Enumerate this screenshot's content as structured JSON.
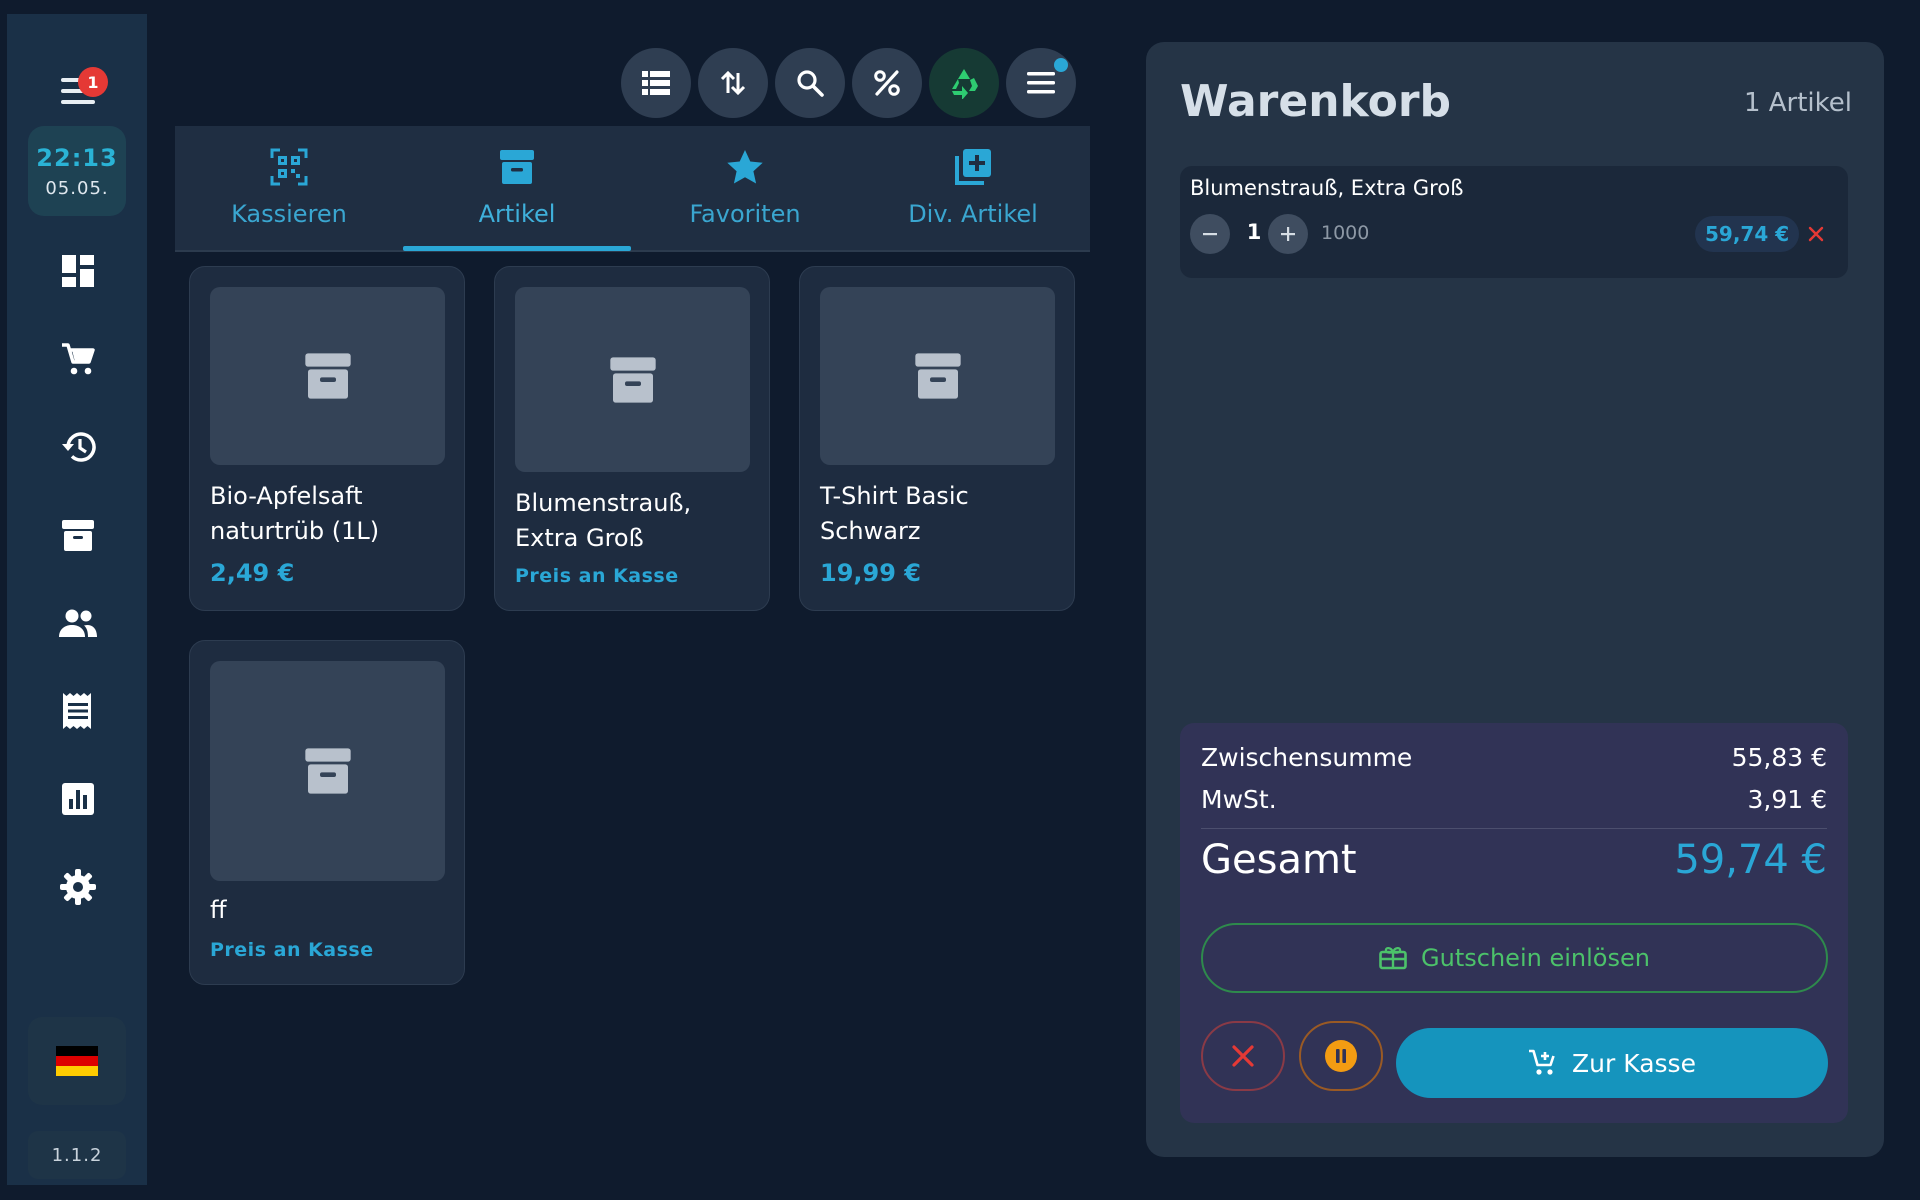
{
  "sidebar": {
    "menu_badge": "1",
    "clock_time": "22:13",
    "clock_date": "05.05.",
    "nav_icons": [
      "dashboard-icon",
      "cart-icon",
      "history-icon",
      "archive-icon",
      "customers-icon",
      "receipt-icon",
      "report-icon",
      "settings-icon"
    ],
    "language_flag": "de-flag-icon",
    "version": "1.1.2"
  },
  "toolbar": {
    "icons": [
      "list-view-icon",
      "sort-icon",
      "search-icon",
      "discount-icon",
      "recycle-icon",
      "menu-icon"
    ]
  },
  "tabs": [
    {
      "label": "Kassieren",
      "icon": "qr-scan-icon"
    },
    {
      "label": "Artikel",
      "icon": "archive-icon"
    },
    {
      "label": "Favoriten",
      "icon": "star-icon"
    },
    {
      "label": "Div. Artikel",
      "icon": "add-item-icon"
    }
  ],
  "active_tab": "Artikel",
  "products": [
    {
      "name": "Bio-Apfelsaft naturtrüb (1L)",
      "price": "2,49 €"
    },
    {
      "name": "Blumenstrauß, Extra Groß",
      "price": "Preis an Kasse"
    },
    {
      "name": "T-Shirt Basic Schwarz",
      "price": "19,99 €"
    },
    {
      "name": "ff",
      "price": "Preis an Kasse"
    }
  ],
  "cart": {
    "title": "Warenkorb",
    "count": "1 Artikel",
    "items": [
      {
        "name": "Blumenstrauß, Extra Groß",
        "qty": "1",
        "sku": "1000",
        "price": "59,74 €"
      }
    ],
    "subtotal_label": "Zwischensumme",
    "subtotal_value": "55,83 €",
    "tax_label": "MwSt.",
    "tax_value": "3,91 €",
    "total_label": "Gesamt",
    "total_value": "59,74 €",
    "voucher_label": "Gutschein einlösen",
    "checkout_label": "Zur Kasse"
  },
  "colors": {
    "accent": "#2aa7d6",
    "background": "#0f1b2d",
    "sidebar": "#1a3047",
    "voucher_green": "#4cc26a",
    "danger": "#e53935",
    "pause": "#f39c12"
  }
}
